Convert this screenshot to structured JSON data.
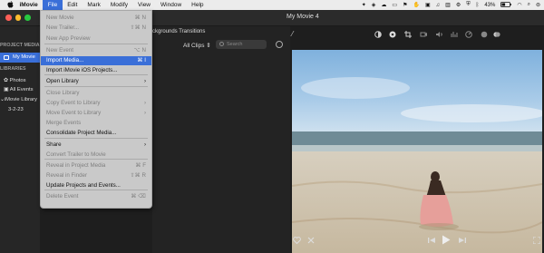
{
  "menubar": {
    "app": "iMovie",
    "items": [
      "File",
      "Edit",
      "Mark",
      "Modify",
      "View",
      "Window",
      "Help"
    ],
    "battery": "43%",
    "icons": [
      "apple-icon",
      "sparkle-icon",
      "dropbox-icon",
      "cloud-icon",
      "cast-icon",
      "flag-icon",
      "hand-icon",
      "box-icon",
      "music-icon",
      "sidebar-icon",
      "adjust-icon",
      "shield-icon",
      "bluetooth-icon",
      "battery-icon",
      "wifi-icon",
      "search-icon",
      "control-center-icon"
    ]
  },
  "window": {
    "title": "My Movie 4"
  },
  "sidebar": {
    "project_header": "PROJECT MEDIA",
    "selected": "My Movie",
    "libraries_header": "LIBRARIES",
    "items": [
      "Photos",
      "All Events",
      "iMovie Library",
      "3-2-23"
    ]
  },
  "browser": {
    "tabs": "ckgrounds  Transitions",
    "filter": "All Clips",
    "search_placeholder": "Search"
  },
  "file_menu": {
    "rows": [
      {
        "label": "New Movie",
        "shortcut": "⌘ N",
        "enabled": false
      },
      {
        "label": "New Trailer...",
        "shortcut": "⇧⌘ N",
        "enabled": false
      },
      {
        "label": "New App Preview",
        "shortcut": "",
        "enabled": false
      },
      {
        "label": "New Event",
        "shortcut": "⌥ N",
        "enabled": false
      },
      {
        "label": "Import Media...",
        "shortcut": "⌘ I",
        "enabled": true,
        "highlighted": true
      },
      {
        "label": "Import iMovie iOS Projects...",
        "shortcut": "",
        "enabled": true
      },
      {
        "label": "Open Library",
        "shortcut": "",
        "enabled": true,
        "submenu": true
      },
      {
        "label": "Close Library",
        "shortcut": "",
        "enabled": false
      },
      {
        "label": "Copy Event to Library",
        "shortcut": "",
        "enabled": false,
        "submenu": true
      },
      {
        "label": "Move Event to Library",
        "shortcut": "",
        "enabled": false,
        "submenu": true
      },
      {
        "label": "Merge Events",
        "shortcut": "",
        "enabled": false
      },
      {
        "label": "Consolidate Project Media...",
        "shortcut": "",
        "enabled": true
      },
      {
        "label": "Share",
        "shortcut": "",
        "enabled": true,
        "submenu": true
      },
      {
        "label": "Convert Trailer to Movie",
        "shortcut": "",
        "enabled": false
      },
      {
        "label": "Reveal in Project Media",
        "shortcut": "⌘ F",
        "enabled": false
      },
      {
        "label": "Reveal in Finder",
        "shortcut": "⇧⌘ R",
        "enabled": false
      },
      {
        "label": "Update Projects and Events...",
        "shortcut": "",
        "enabled": true
      },
      {
        "label": "Delete Event",
        "shortcut": "⌘ ⌫",
        "enabled": false
      }
    ]
  },
  "viewer": {
    "tools": [
      "magic-wand-icon",
      "color-balance-icon",
      "color-wheel-icon",
      "crop-icon",
      "stabilize-icon",
      "volume-icon",
      "equalizer-icon",
      "speed-icon",
      "noise-icon",
      "info-icon"
    ]
  },
  "colors": {
    "accent": "#3a6fd8",
    "menu_bg": "#c9c9c9",
    "window_bg": "#1e1e1e"
  }
}
